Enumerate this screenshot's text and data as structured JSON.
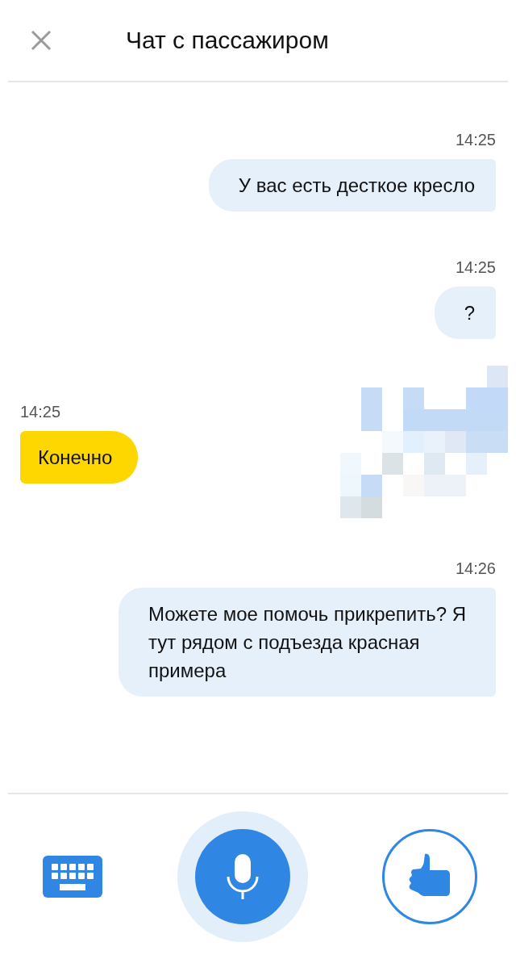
{
  "header": {
    "title": "Чат с пассажиром"
  },
  "messages": [
    {
      "kind": "outgoing",
      "time": "14:25",
      "text": "У вас есть десткое кресло"
    },
    {
      "kind": "outgoing",
      "time": "14:25",
      "text": "?"
    },
    {
      "kind": "incoming",
      "time": "14:25",
      "text": "Конечно",
      "pixelated": true
    },
    {
      "kind": "outgoing",
      "time": "14:26",
      "text": "Можете мое помочь прикрепить? Я тут рядом с подъезда красная примера"
    }
  ],
  "composer": {
    "recording": true
  }
}
